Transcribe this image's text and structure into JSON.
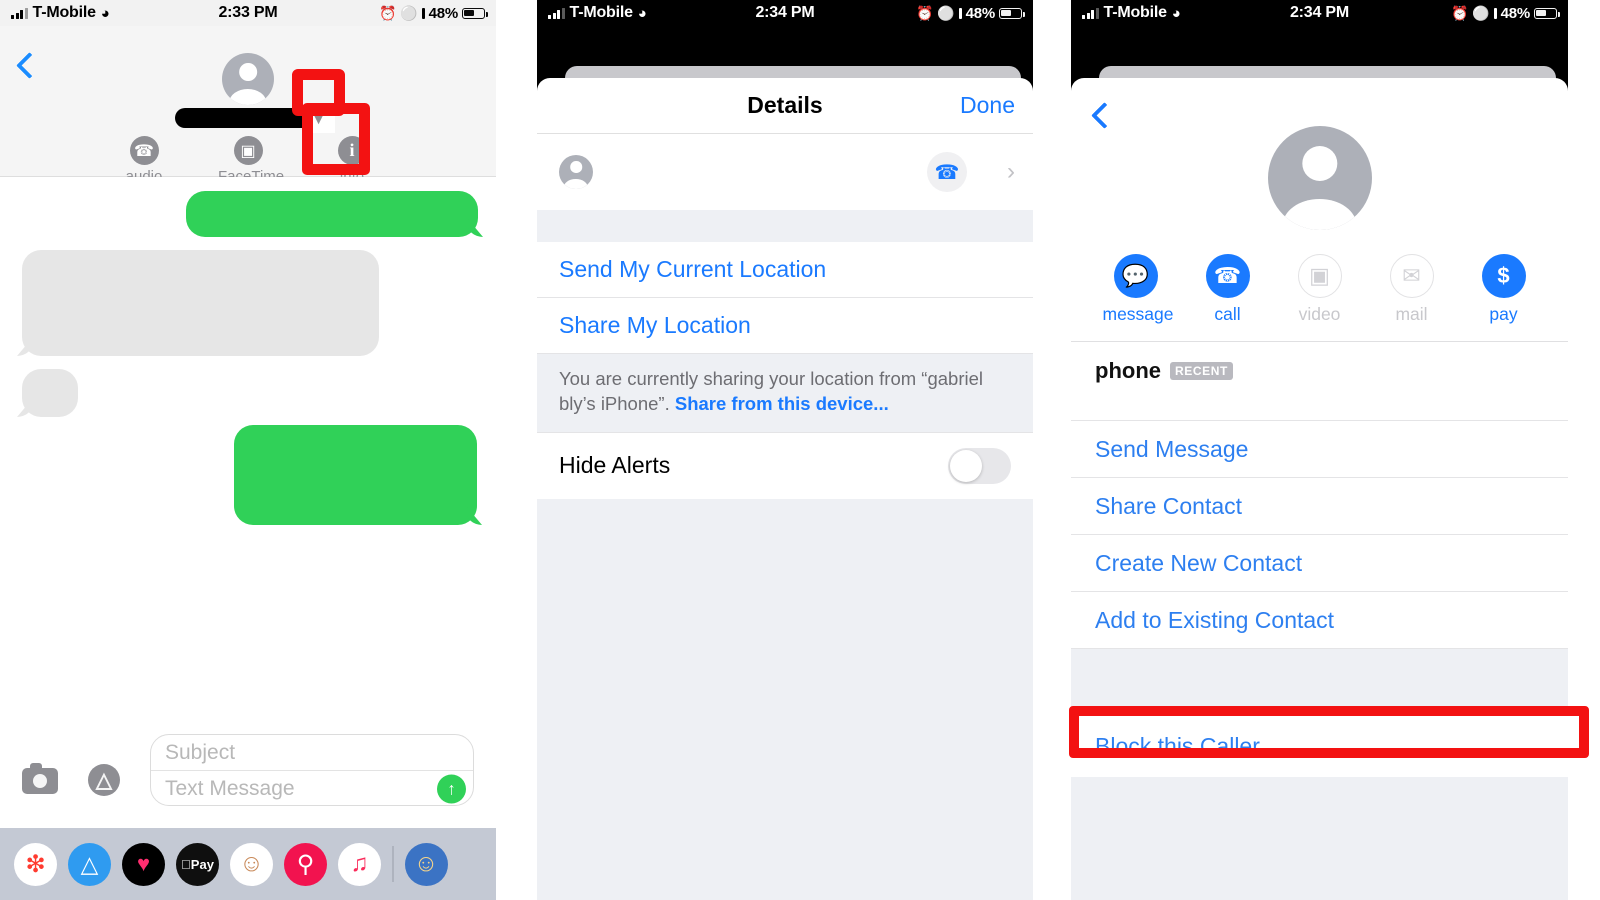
{
  "meta": {
    "accent_blue": "#1a7aff",
    "accent_green": "#30d158",
    "annotation_red": "#f31212",
    "grey_text": "#8e8e93"
  },
  "panel1": {
    "statusbar": {
      "carrier": "T-Mobile",
      "wifi_icon": "wifi-icon",
      "signal_icon": "cellular-signal-icon",
      "time": "2:33 PM",
      "alarm_icon": "alarm-clock-icon",
      "headphones_icon": "headphones-icon",
      "battery_percent": "48%",
      "battery_icon": "battery-icon"
    },
    "header": {
      "back_icon": "back-chevron-icon",
      "avatar_icon": "contact-avatar-icon",
      "contact_name": "",
      "expand_icon": "chevron-down-icon",
      "actions": [
        {
          "icon": "phone-icon",
          "label": "audio"
        },
        {
          "icon": "video-camera-icon",
          "label": "FaceTime"
        },
        {
          "icon": "info-icon",
          "label": "info"
        }
      ]
    },
    "messages": [
      {
        "side": "outgoing",
        "text": ""
      },
      {
        "side": "incoming",
        "text": ""
      },
      {
        "side": "incoming",
        "text": ""
      },
      {
        "side": "outgoing",
        "text": ""
      }
    ],
    "composer": {
      "camera_icon": "camera-icon",
      "appstore_icon": "app-store-icon",
      "subject_placeholder": "Subject",
      "subject_value": "",
      "text_placeholder": "Text Message",
      "text_value": "",
      "send_icon": "send-arrow-up-icon"
    },
    "dock": [
      {
        "name": "photos-app-icon",
        "glyph": "❋",
        "bg": "#ffffff",
        "fg": "#ff3b30"
      },
      {
        "name": "app-store-app-icon",
        "glyph": "A",
        "bg": "#2f9bf0",
        "fg": "#ffffff"
      },
      {
        "name": "music-heart-app-icon",
        "glyph": "♥",
        "bg": "#000000",
        "fg": "#ff2d6f"
      },
      {
        "name": "apple-pay-app-icon",
        "glyph": "Pay",
        "bg": "#0f0f0f",
        "fg": "#ffffff"
      },
      {
        "name": "memoji-app-icon",
        "glyph": "☻",
        "bg": "#ffffff",
        "fg": "#c98a5a"
      },
      {
        "name": "image-search-app-icon",
        "glyph": "⌕",
        "bg": "#f2134f",
        "fg": "#ffffff"
      },
      {
        "name": "music-app-icon",
        "glyph": "♫",
        "bg": "#ffffff",
        "fg": "#fa2a5a"
      },
      {
        "name": "avatar-app-icon",
        "glyph": "☻",
        "bg": "#3b73c4",
        "fg": "#f5d48a"
      }
    ]
  },
  "panel2": {
    "statusbar": {
      "carrier": "T-Mobile",
      "time": "2:34 PM",
      "battery_percent": "48%"
    },
    "nav": {
      "title": "Details",
      "done_label": "Done"
    },
    "contact_row": {
      "avatar_icon": "contact-avatar-icon",
      "name": "",
      "call_icon": "phone-icon",
      "chevron_icon": "chevron-right-icon"
    },
    "rows": [
      {
        "label": "Send My Current Location",
        "name": "send-my-current-location"
      },
      {
        "label": "Share My Location",
        "name": "share-my-location"
      }
    ],
    "note": {
      "text_before": "You are currently sharing your location from “gabriel bly’s iPhone”. ",
      "link": "Share from this device..."
    },
    "hide_alerts": {
      "label": "Hide Alerts",
      "toggle_state": "off"
    }
  },
  "panel3": {
    "statusbar": {
      "carrier": "T-Mobile",
      "time": "2:34 PM",
      "battery_percent": "48%"
    },
    "back_icon": "back-chevron-icon",
    "avatar_icon": "contact-avatar-icon",
    "quick_actions": [
      {
        "label": "message",
        "icon": "message-bubble-icon",
        "enabled": true
      },
      {
        "label": "call",
        "icon": "phone-icon",
        "enabled": true
      },
      {
        "label": "video",
        "icon": "video-camera-icon",
        "enabled": false
      },
      {
        "label": "mail",
        "icon": "envelope-icon",
        "enabled": false
      },
      {
        "label": "pay",
        "icon": "dollar-sign-icon",
        "enabled": true
      }
    ],
    "phone_field": {
      "label": "phone",
      "badge": "RECENT",
      "value": ""
    },
    "links": [
      {
        "label": "Send Message",
        "name": "send-message"
      },
      {
        "label": "Share Contact",
        "name": "share-contact"
      },
      {
        "label": "Create New Contact",
        "name": "create-new-contact"
      },
      {
        "label": "Add to Existing Contact",
        "name": "add-to-existing-contact"
      }
    ],
    "block_row": {
      "label": "Block this Caller",
      "name": "block-this-caller"
    }
  }
}
